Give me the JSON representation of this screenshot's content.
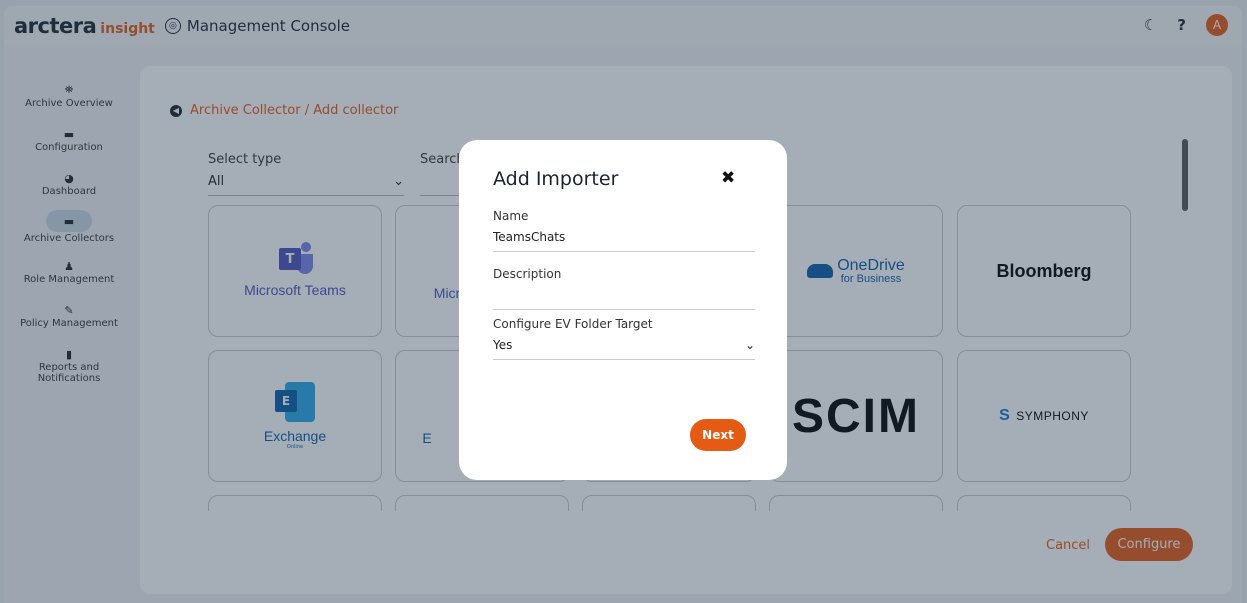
{
  "topbar": {
    "brand_main": "arctera",
    "brand_sub": "insight",
    "title": "Management Console",
    "console_icon": "console-icon",
    "theme_icon": "moon-icon",
    "help_icon": "?",
    "avatar_initial": "A"
  },
  "sidebar": {
    "items": [
      {
        "label": "Archive Overview",
        "icon": "binoculars-icon",
        "glyph": "⛯"
      },
      {
        "label": "Configuration",
        "icon": "archive-box-icon",
        "glyph": "▬"
      },
      {
        "label": "Dashboard",
        "icon": "gauge-icon",
        "glyph": "◕"
      },
      {
        "label": "Archive Collectors",
        "icon": "archive-box-icon",
        "glyph": "▬"
      },
      {
        "label": "Role Management",
        "icon": "user-plus-icon",
        "glyph": "♟"
      },
      {
        "label": "Policy Management",
        "icon": "edit-icon",
        "glyph": "✎"
      },
      {
        "label": "Reports and Notifications",
        "icon": "bar-chart-icon",
        "glyph": "▮"
      }
    ]
  },
  "breadcrumb": {
    "text": "Archive Collector / Add collector"
  },
  "filters": {
    "select_type_label": "Select type",
    "select_type_value": "All",
    "search_label": "Search"
  },
  "cards": {
    "teams": "Microsoft Teams",
    "teams_letter": "T",
    "ms_partial": "Micr",
    "onedrive_title": "OneDrive",
    "onedrive_sub": "for Business",
    "bloomberg": "Bloomberg",
    "exchange": "Exchange",
    "exchange_sub": "Online",
    "exchange_letter": "E",
    "ex_partial": "E",
    "scim": "SCIM",
    "symphony": "SYMPHONY",
    "symphony_s": "S"
  },
  "footer": {
    "cancel": "Cancel",
    "configure": "Configure"
  },
  "modal": {
    "title": "Add Importer",
    "name_label": "Name",
    "name_value": "TeamsChats",
    "description_label": "Description",
    "description_value": "",
    "ev_label": "Configure EV Folder Target",
    "ev_value": "Yes",
    "next": "Next"
  }
}
